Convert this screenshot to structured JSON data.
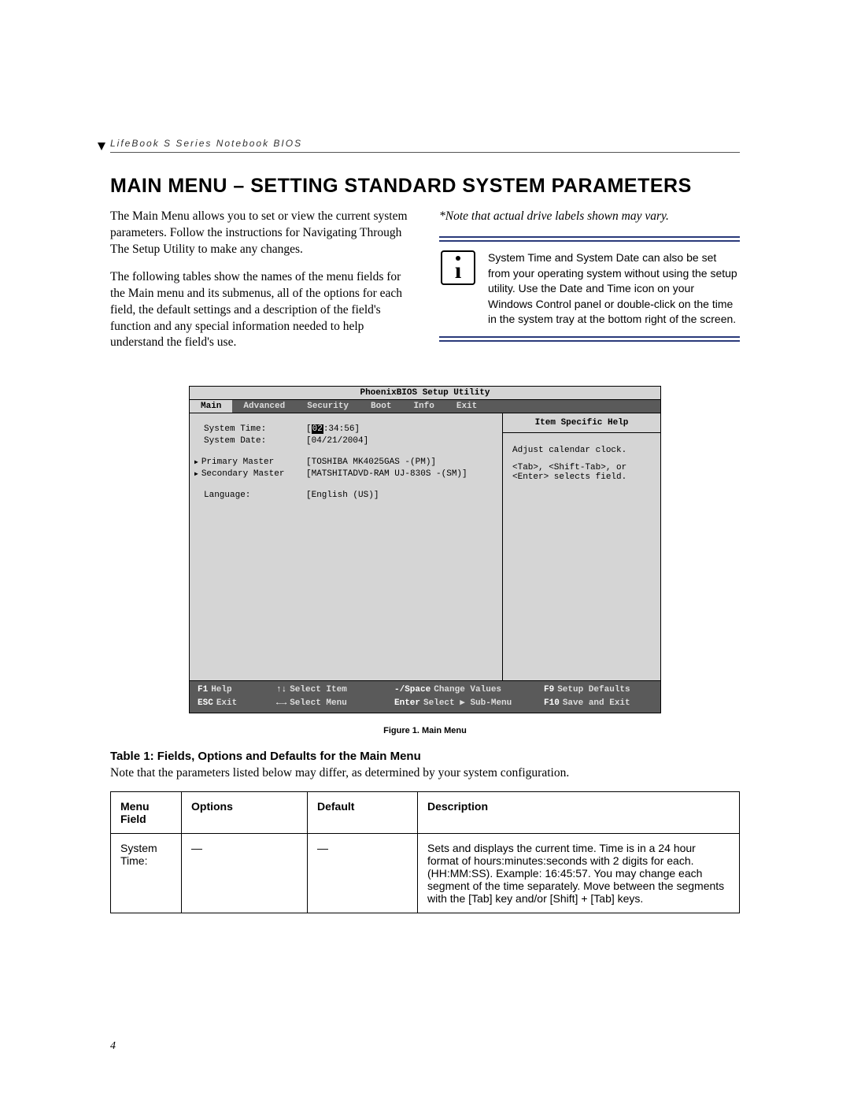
{
  "header": {
    "running_head": "LifeBook S Series Notebook BIOS"
  },
  "title": "MAIN MENU – SETTING STANDARD SYSTEM PARAMETERS",
  "intro": {
    "p1": "The Main Menu allows you to set or view the current system parameters. Follow the instructions for Navigating Through The Setup Utility to make any changes.",
    "p2": "The following tables show the names of the menu fields for the Main menu and its submenus, all of the options for each field, the default settings and a description of the field's function and any special information needed to help understand the field's use.",
    "note": "*Note that actual drive labels shown may vary.",
    "info": "System Time and System Date can also be set from your operating system without using the setup utility. Use the Date and Time icon on your Windows Control panel or double-click on the time in the system tray at the bottom right of the screen."
  },
  "bios": {
    "title": "PhoenixBIOS Setup Utility",
    "tabs": [
      "Main",
      "Advanced",
      "Security",
      "Boot",
      "Info",
      "Exit"
    ],
    "fields": {
      "system_time_label": "System Time:",
      "system_time_val_hl": "02",
      "system_time_val_rest": ":34:56]",
      "system_date_label": "System Date:",
      "system_date_val": "[04/21/2004]",
      "primary_label": "Primary Master",
      "primary_val": "[TOSHIBA MK4025GAS -(PM)]",
      "secondary_label": "Secondary Master",
      "secondary_val": "[MATSHITADVD-RAM UJ-830S -(SM)]",
      "language_label": "Language:",
      "language_val": "[English (US)]"
    },
    "help": {
      "title": "Item Specific Help",
      "line1": "Adjust calendar clock.",
      "line2": "<Tab>, <Shift-Tab>, or <Enter> selects field."
    },
    "footer": {
      "r1a_key": "F1",
      "r1a_txt": "Help",
      "r1b_key": "↑↓",
      "r1b_txt": "Select Item",
      "r1c_key": "-/Space",
      "r1c_txt": "Change Values",
      "r1d_key": "F9",
      "r1d_txt": "Setup Defaults",
      "r2a_key": "ESC",
      "r2a_txt": "Exit",
      "r2b_key": "←→",
      "r2b_txt": "Select Menu",
      "r2c_key": "Enter",
      "r2c_txt": "Select ▶ Sub-Menu",
      "r2d_key": "F10",
      "r2d_txt": "Save and Exit"
    }
  },
  "figure_caption": "Figure 1.  Main Menu",
  "table": {
    "title": "Table 1: Fields, Options and Defaults for the Main Menu",
    "note": "Note that the parameters listed below may differ, as determined by your system configuration.",
    "headers": {
      "c1": "Menu Field",
      "c2": "Options",
      "c3": "Default",
      "c4": "Description"
    },
    "row1": {
      "field": "System Time:",
      "options": "—",
      "default": "—",
      "desc": "Sets and displays the current time. Time is in a 24 hour format of hours:minutes:seconds with 2 digits for each. (HH:MM:SS). Example: 16:45:57. You may change each segment of the time separately. Move between the segments with the [Tab] key and/or [Shift] + [Tab] keys."
    }
  },
  "page_number": "4"
}
